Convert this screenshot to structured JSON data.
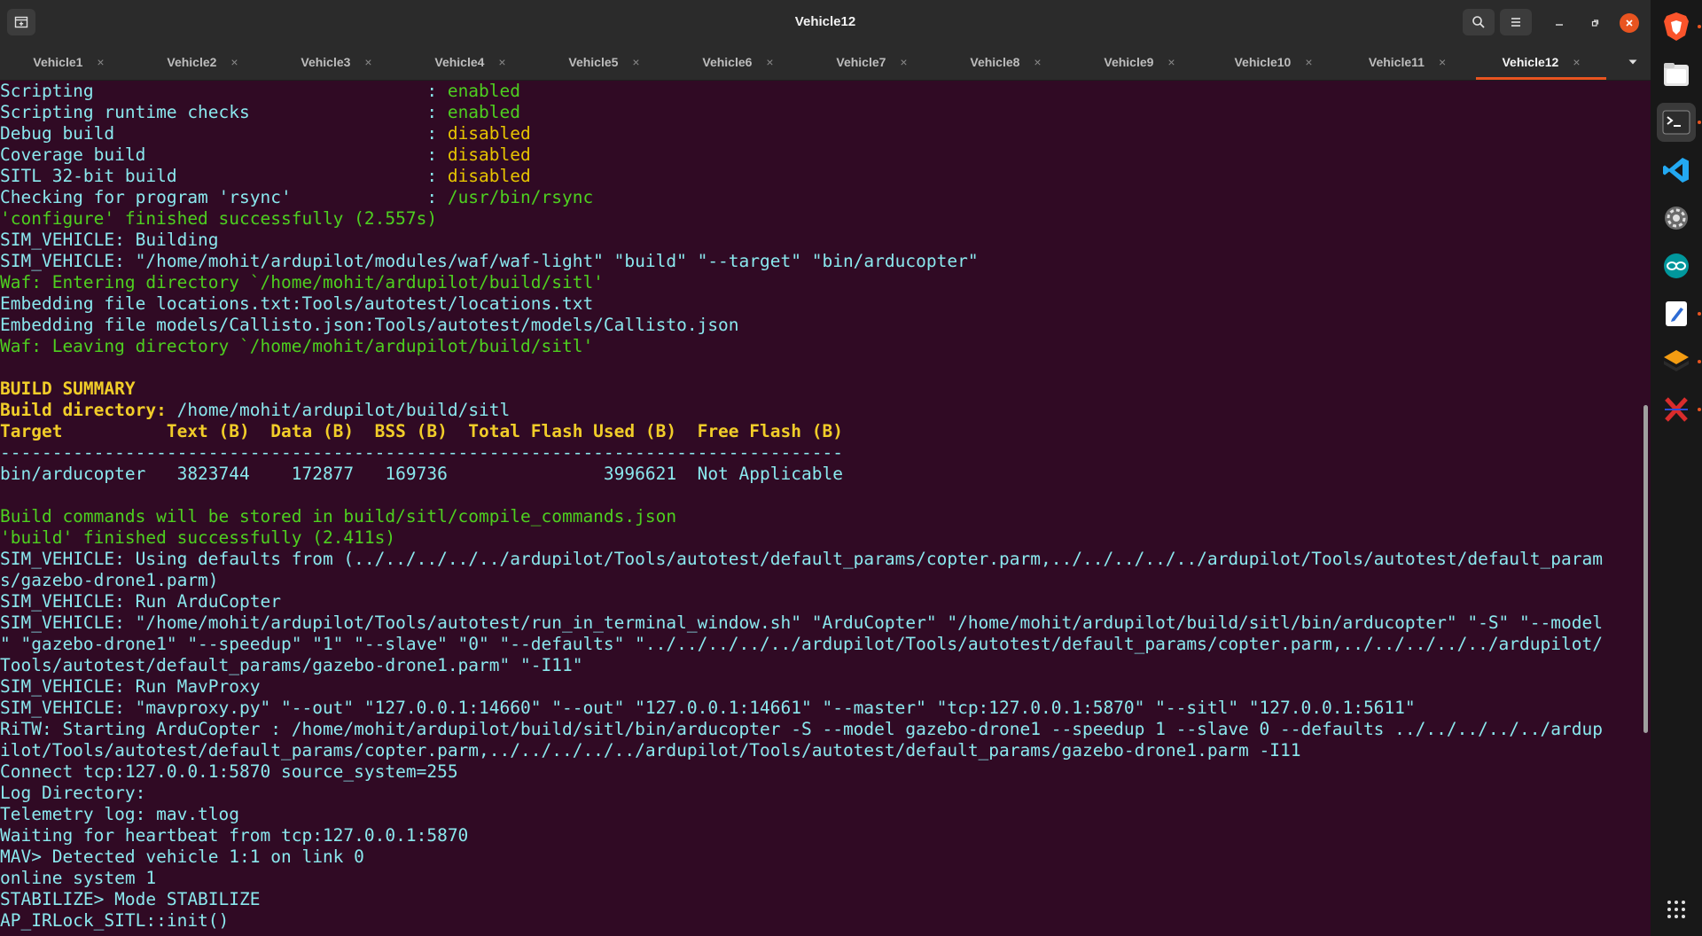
{
  "window": {
    "title": "Vehicle12"
  },
  "tabs": [
    {
      "label": "Vehicle1"
    },
    {
      "label": "Vehicle2"
    },
    {
      "label": "Vehicle3"
    },
    {
      "label": "Vehicle4"
    },
    {
      "label": "Vehicle5"
    },
    {
      "label": "Vehicle6"
    },
    {
      "label": "Vehicle7"
    },
    {
      "label": "Vehicle8"
    },
    {
      "label": "Vehicle9"
    },
    {
      "label": "Vehicle10"
    },
    {
      "label": "Vehicle11"
    },
    {
      "label": "Vehicle12",
      "active": true
    }
  ],
  "tab_close_glyph": "×",
  "colors": {
    "terminal_bg": "#300a24",
    "text_cyan": "#8ae8ee",
    "text_green": "#4ecf20",
    "text_yellow": "#e7c400",
    "accent": "#e95420"
  },
  "terminal": {
    "lines": [
      {
        "segments": [
          {
            "t": "Scripting                                : ",
            "c": "c"
          },
          {
            "t": "enabled",
            "c": "g"
          }
        ]
      },
      {
        "segments": [
          {
            "t": "Scripting runtime checks                 : ",
            "c": "c"
          },
          {
            "t": "enabled",
            "c": "g"
          }
        ]
      },
      {
        "segments": [
          {
            "t": "Debug build                              : ",
            "c": "c"
          },
          {
            "t": "disabled",
            "c": "y"
          }
        ]
      },
      {
        "segments": [
          {
            "t": "Coverage build                           : ",
            "c": "c"
          },
          {
            "t": "disabled",
            "c": "y"
          }
        ]
      },
      {
        "segments": [
          {
            "t": "SITL 32-bit build                        : ",
            "c": "c"
          },
          {
            "t": "disabled",
            "c": "y"
          }
        ]
      },
      {
        "segments": [
          {
            "t": "Checking for program 'rsync'             : ",
            "c": "c"
          },
          {
            "t": "/usr/bin/rsync",
            "c": "g"
          }
        ]
      },
      {
        "segments": [
          {
            "t": "'configure' finished successfully (2.557s)",
            "c": "g"
          }
        ]
      },
      {
        "segments": [
          {
            "t": "SIM_VEHICLE: Building",
            "c": "c"
          }
        ]
      },
      {
        "segments": [
          {
            "t": "SIM_VEHICLE: \"/home/mohit/ardupilot/modules/waf/waf-light\" \"build\" \"--target\" \"bin/arducopter\"",
            "c": "c"
          }
        ]
      },
      {
        "segments": [
          {
            "t": "Waf: Entering directory `/home/mohit/ardupilot/build/sitl'",
            "c": "g"
          }
        ]
      },
      {
        "segments": [
          {
            "t": "Embedding file locations.txt:Tools/autotest/locations.txt",
            "c": "c"
          }
        ]
      },
      {
        "segments": [
          {
            "t": "Embedding file models/Callisto.json:Tools/autotest/models/Callisto.json",
            "c": "c"
          }
        ]
      },
      {
        "segments": [
          {
            "t": "Waf: Leaving directory `/home/mohit/ardupilot/build/sitl'",
            "c": "g"
          }
        ]
      },
      {
        "segments": [
          {
            "t": "",
            "c": "c"
          }
        ]
      },
      {
        "segments": [
          {
            "t": "BUILD SUMMARY",
            "c": "yb"
          }
        ]
      },
      {
        "segments": [
          {
            "t": "Build directory: ",
            "c": "yb"
          },
          {
            "t": "/home/mohit/ardupilot/build/sitl",
            "c": "c"
          }
        ]
      },
      {
        "segments": [
          {
            "t": "Target          Text (B)  Data (B)  BSS (B)  Total Flash Used (B)  Free Flash (B)",
            "c": "yb"
          }
        ]
      },
      {
        "segments": [
          {
            "t": "---------------------------------------------------------------------------------",
            "c": "c"
          }
        ]
      },
      {
        "segments": [
          {
            "t": "bin/arducopter   3823744    172877   169736               3996621  Not Applicable",
            "c": "c"
          }
        ]
      },
      {
        "segments": [
          {
            "t": "",
            "c": "c"
          }
        ]
      },
      {
        "segments": [
          {
            "t": "Build commands will be stored in build/sitl/compile_commands.json",
            "c": "g"
          }
        ]
      },
      {
        "segments": [
          {
            "t": "'build' finished successfully (2.411s)",
            "c": "g"
          }
        ]
      },
      {
        "segments": [
          {
            "t": "SIM_VEHICLE: Using defaults from (../../../../../ardupilot/Tools/autotest/default_params/copter.parm,../../../../../ardupilot/Tools/autotest/default_param",
            "c": "c"
          }
        ]
      },
      {
        "segments": [
          {
            "t": "s/gazebo-drone1.parm)",
            "c": "c"
          }
        ]
      },
      {
        "segments": [
          {
            "t": "SIM_VEHICLE: Run ArduCopter",
            "c": "c"
          }
        ]
      },
      {
        "segments": [
          {
            "t": "SIM_VEHICLE: \"/home/mohit/ardupilot/Tools/autotest/run_in_terminal_window.sh\" \"ArduCopter\" \"/home/mohit/ardupilot/build/sitl/bin/arducopter\" \"-S\" \"--model",
            "c": "c"
          }
        ]
      },
      {
        "segments": [
          {
            "t": "\" \"gazebo-drone1\" \"--speedup\" \"1\" \"--slave\" \"0\" \"--defaults\" \"../../../../../ardupilot/Tools/autotest/default_params/copter.parm,../../../../../ardupilot/",
            "c": "c"
          }
        ]
      },
      {
        "segments": [
          {
            "t": "Tools/autotest/default_params/gazebo-drone1.parm\" \"-I11\"",
            "c": "c"
          }
        ]
      },
      {
        "segments": [
          {
            "t": "SIM_VEHICLE: Run MavProxy",
            "c": "c"
          }
        ]
      },
      {
        "segments": [
          {
            "t": "SIM_VEHICLE: \"mavproxy.py\" \"--out\" \"127.0.0.1:14660\" \"--out\" \"127.0.0.1:14661\" \"--master\" \"tcp:127.0.0.1:5870\" \"--sitl\" \"127.0.0.1:5611\"",
            "c": "c"
          }
        ]
      },
      {
        "segments": [
          {
            "t": "RiTW: Starting ArduCopter : /home/mohit/ardupilot/build/sitl/bin/arducopter -S --model gazebo-drone1 --speedup 1 --slave 0 --defaults ../../../../../ardup",
            "c": "c"
          }
        ]
      },
      {
        "segments": [
          {
            "t": "ilot/Tools/autotest/default_params/copter.parm,../../../../../ardupilot/Tools/autotest/default_params/gazebo-drone1.parm -I11",
            "c": "c"
          }
        ]
      },
      {
        "segments": [
          {
            "t": "Connect tcp:127.0.0.1:5870 source_system=255",
            "c": "c"
          }
        ]
      },
      {
        "segments": [
          {
            "t": "Log Directory:",
            "c": "c"
          }
        ]
      },
      {
        "segments": [
          {
            "t": "Telemetry log: mav.tlog",
            "c": "c"
          }
        ]
      },
      {
        "segments": [
          {
            "t": "Waiting for heartbeat from tcp:127.0.0.1:5870",
            "c": "c"
          }
        ]
      },
      {
        "segments": [
          {
            "t": "MAV> Detected vehicle 1:1 on link 0",
            "c": "c"
          }
        ]
      },
      {
        "segments": [
          {
            "t": "online system 1",
            "c": "c"
          }
        ]
      },
      {
        "segments": [
          {
            "t": "STABILIZE> Mode STABILIZE",
            "c": "c"
          }
        ]
      },
      {
        "segments": [
          {
            "t": "AP_IRLock_SITL::init()",
            "c": "c"
          }
        ]
      }
    ]
  },
  "dock": {
    "items": [
      {
        "name": "brave-browser-icon"
      },
      {
        "name": "files-icon"
      },
      {
        "name": "terminal-icon"
      },
      {
        "name": "vscode-icon"
      },
      {
        "name": "settings-icon"
      },
      {
        "name": "arduino-icon"
      },
      {
        "name": "text-editor-icon"
      },
      {
        "name": "layers-app-icon"
      },
      {
        "name": "x-app-icon"
      }
    ]
  }
}
